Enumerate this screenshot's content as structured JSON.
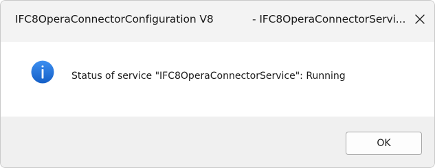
{
  "window": {
    "title_left": "IFC8OperaConnectorConfiguration V8",
    "title_right": "- IFC8OperaConnectorServi...",
    "close_icon": "close-icon"
  },
  "content": {
    "icon": "info-icon",
    "message": "Status of service \"IFC8OperaConnectorService\":  Running"
  },
  "footer": {
    "ok_label": "OK"
  },
  "colors": {
    "info_icon_fill": "#1f6fd6",
    "titlebar_bg": "#f3f3f3",
    "footer_bg": "#f0f0f0"
  }
}
